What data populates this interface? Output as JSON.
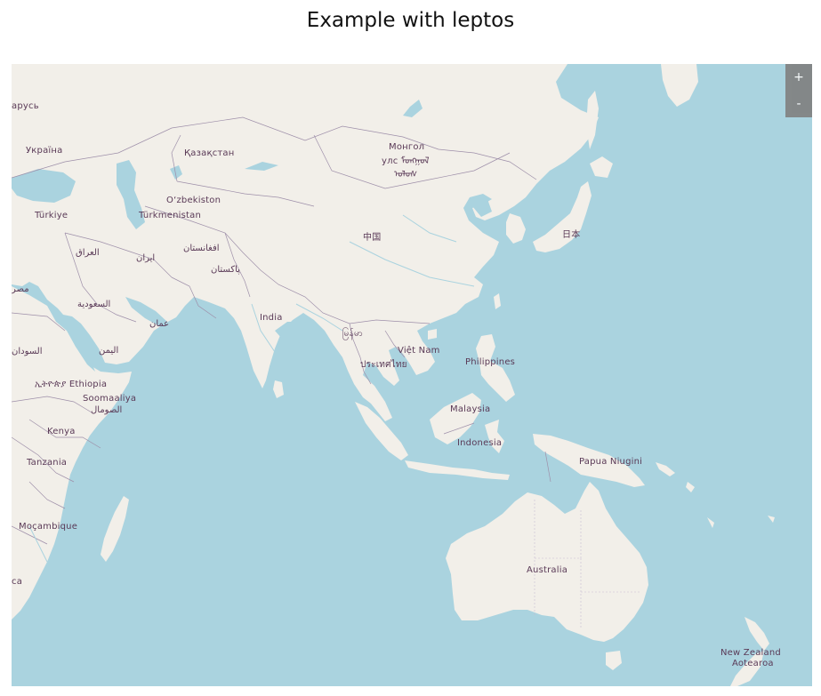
{
  "page": {
    "title": "Example with leptos"
  },
  "zoom": {
    "in_label": "+",
    "out_label": "-"
  },
  "colors": {
    "water": "#aad3df",
    "land": "#f2efe9",
    "border": "#9e8fa9",
    "label": "#5a3a57"
  },
  "labels": {
    "belarus": "арусь",
    "ukraine": "Україна",
    "kazakhstan": "Қазақстан",
    "mongolia_1": "Монгол",
    "mongolia_2": "улс ᠮᠣᠩᠭᠣᠯ",
    "mongolia_3": "ᠤᠯᠤᠰ",
    "turkiye": "Türkiye",
    "uzbekistan": "O‘zbekiston",
    "turkmenistan": "Türkmenistan",
    "iraq": "العراق",
    "iran": "ایران",
    "afghanistan": "افغانستان",
    "pakistan": "پاکستان",
    "china": "中国",
    "japan": "日本",
    "egypt": "مصر",
    "saudi": "السعودية",
    "oman": "عمان",
    "india": "India",
    "myanmar": "မြန်မာ",
    "vietnam": "Việt Nam",
    "thailand": "ประเทศไทย",
    "philippines": "Philippines",
    "sudan": "السودان",
    "yemen": "اليمن",
    "ethiopia": "ኢትዮጵያ Ethiopia",
    "somalia_1": "Soomaaliya",
    "somalia_2": "الصومال",
    "malaysia": "Malaysia",
    "indonesia": "Indonesia",
    "kenya": "Kenya",
    "png": "Papua Niugini",
    "tanzania": "Tanzania",
    "mozambique": "Moçambique",
    "australia": "Australia",
    "africa_fragment": "ca",
    "nz_1": "New Zealand",
    "nz_2": "Aotearoa"
  }
}
